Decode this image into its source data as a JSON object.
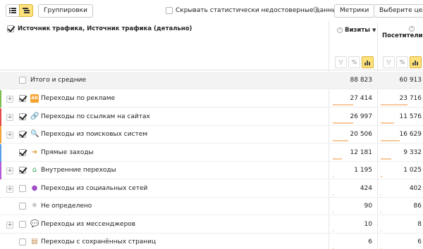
{
  "toolbar": {
    "groups_label": "Группировки",
    "hide_unreliable_label": "Скрывать статистически недостоверные данные",
    "metrics_label": "Метрики",
    "goal_label": "Выберите цель"
  },
  "header": {
    "dimensions_label": "Источник трафика, Источник трафика (детально)",
    "col_visits": "Визиты",
    "col_visitors": "Посетители"
  },
  "total": {
    "label": "Итого и средние",
    "visits": "88 823",
    "visitors": "60 913"
  },
  "rows": [
    {
      "label": "Переходы по рекламе",
      "visits": "27 414",
      "visitors": "23 716",
      "visits_share": 0.309,
      "visitors_share": 0.389,
      "checked": true,
      "expandable": true,
      "color": "#7cbd4c",
      "icon": "ad-icon"
    },
    {
      "label": "Переходы по ссылкам на сайтах",
      "visits": "26 997",
      "visitors": "11 576",
      "visits_share": 0.304,
      "visitors_share": 0.19,
      "checked": true,
      "expandable": true,
      "color": "#e64848",
      "icon": "link-icon"
    },
    {
      "label": "Переходы из поисковых систем",
      "visits": "20 506",
      "visitors": "16 629",
      "visits_share": 0.231,
      "visitors_share": 0.273,
      "checked": true,
      "expandable": true,
      "color": "#f2a23a",
      "icon": "search-icon"
    },
    {
      "label": "Прямые заходы",
      "visits": "12 181",
      "visitors": "9 332",
      "visits_share": 0.137,
      "visitors_share": 0.153,
      "checked": true,
      "expandable": false,
      "color": "#5aa0e8",
      "icon": "direct-arrow-icon"
    },
    {
      "label": "Внутренние переходы",
      "visits": "1 195",
      "visitors": "1 025",
      "visits_share": 0.013,
      "visitors_share": 0.017,
      "checked": true,
      "expandable": true,
      "color": "#b45ad6",
      "icon": "home-icon"
    },
    {
      "label": "Переходы из социальных сетей",
      "visits": "424",
      "visitors": "402",
      "visits_share": 0.005,
      "visitors_share": 0.007,
      "checked": false,
      "expandable": true,
      "color": "",
      "icon": "social-person-icon"
    },
    {
      "label": "Не определено",
      "visits": "90",
      "visitors": "86",
      "visits_share": 0.001,
      "visitors_share": 0.001,
      "checked": false,
      "expandable": false,
      "color": "",
      "icon": "spinner-icon"
    },
    {
      "label": "Переходы из мессенджеров",
      "visits": "10",
      "visitors": "8",
      "visits_share": 0.0001,
      "visitors_share": 0.0001,
      "checked": false,
      "expandable": true,
      "color": "",
      "icon": "chat-bubble-icon"
    },
    {
      "label": "Переходы с сохранённых страниц",
      "visits": "6",
      "visitors": "6",
      "visits_share": 0.0001,
      "visitors_share": 0.0001,
      "checked": false,
      "expandable": false,
      "color": "",
      "icon": "saved-page-icon"
    }
  ],
  "colors": {
    "accent": "#ffe37a",
    "bar": "#f7c89a"
  }
}
